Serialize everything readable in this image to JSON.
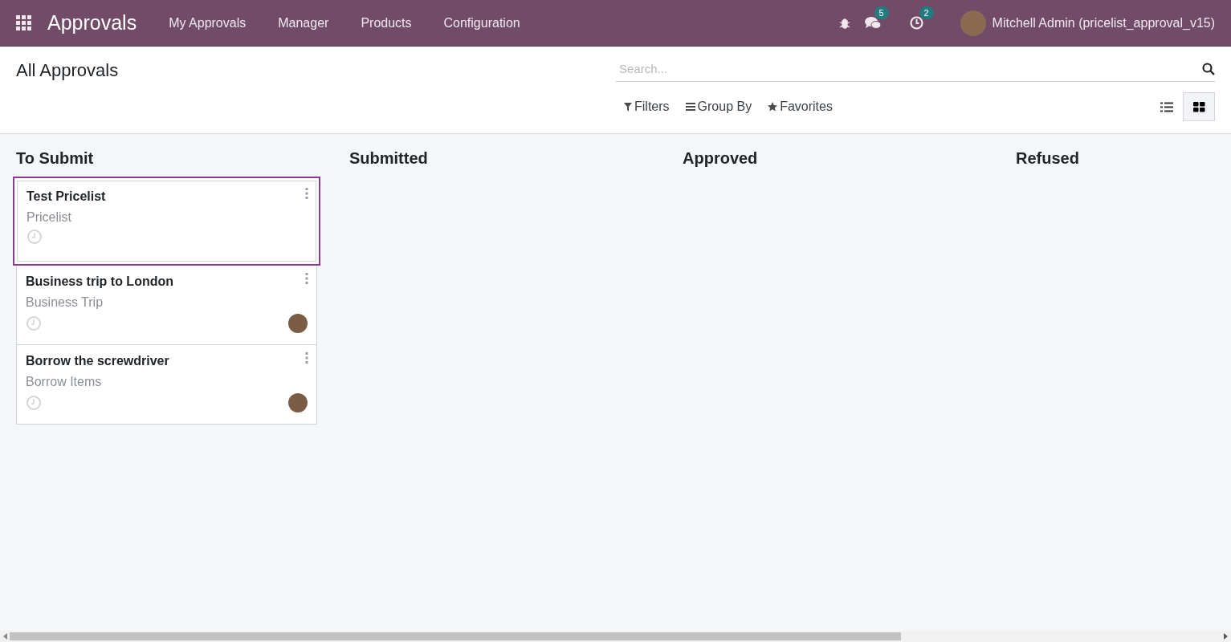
{
  "navbar": {
    "app_name": "Approvals",
    "menu": [
      "My Approvals",
      "Manager",
      "Products",
      "Configuration"
    ],
    "messages_count": "5",
    "activities_count": "2",
    "user": "Mitchell Admin (pricelist_approval_v15)"
  },
  "control_panel": {
    "title": "All Approvals",
    "search": {
      "placeholder": "Search..."
    },
    "filters": [
      "Filters",
      "Group By",
      "Favorites"
    ],
    "views": [
      {
        "kind": "list",
        "selected": false
      },
      {
        "kind": "kanban",
        "selected": true
      }
    ]
  },
  "columns": [
    {
      "title": "To Submit",
      "cards": [
        {
          "title": "Test Pricelist",
          "category": "Pricelist",
          "has_avatar": false,
          "selected": true
        },
        {
          "title": "Business trip to London",
          "category": "Business Trip",
          "has_avatar": true,
          "selected": false
        },
        {
          "title": "Borrow the screwdriver",
          "category": "Borrow Items",
          "has_avatar": true,
          "selected": false
        }
      ]
    },
    {
      "title": "Submitted"
    },
    {
      "title": "Approved"
    },
    {
      "title": "Refused"
    }
  ]
}
